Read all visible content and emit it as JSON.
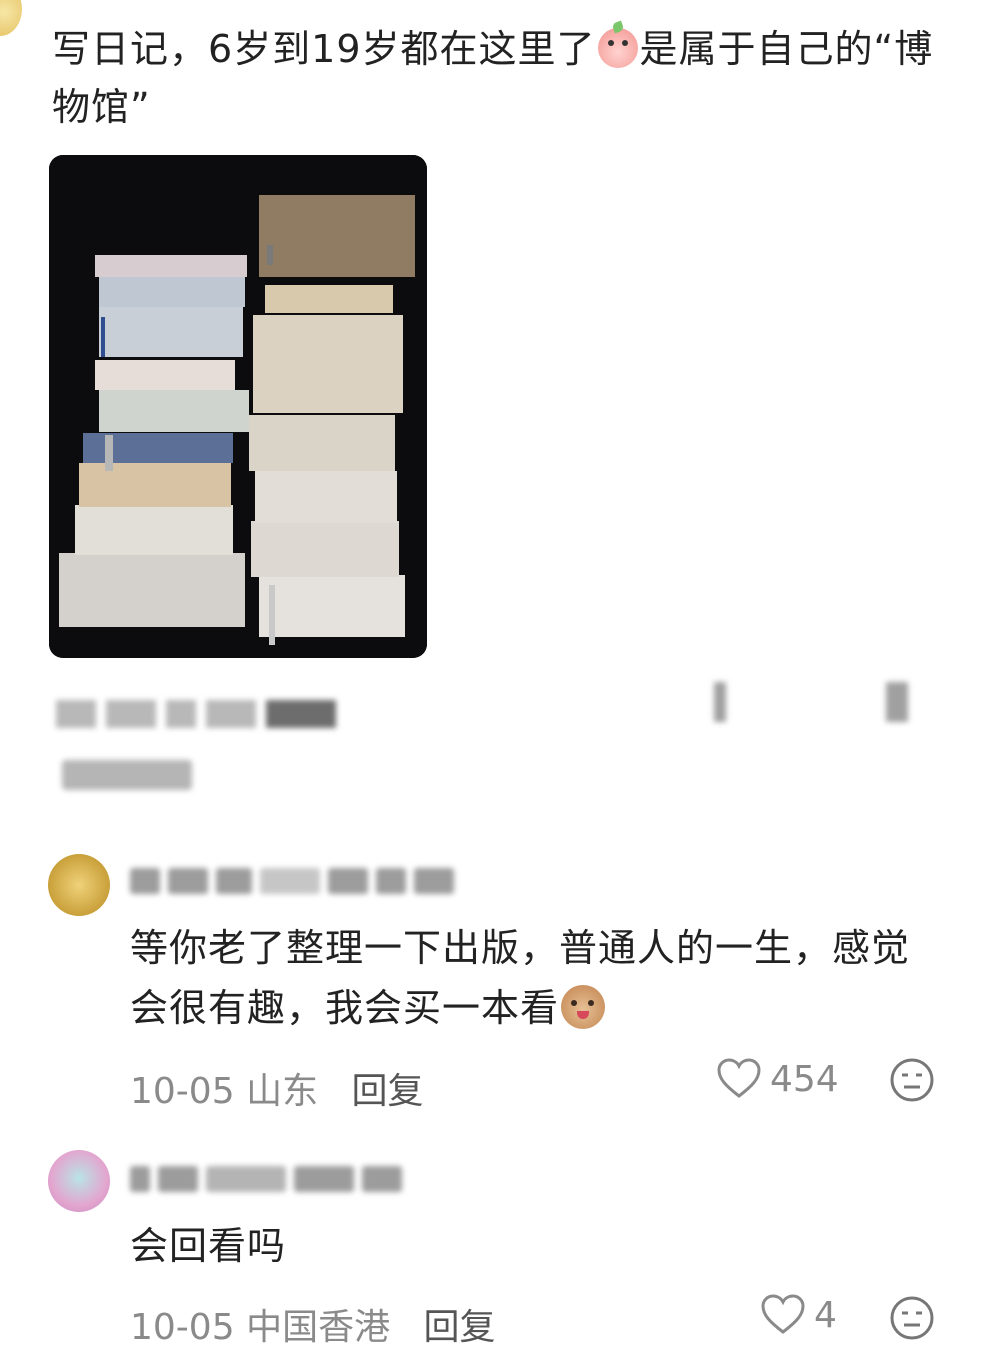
{
  "post": {
    "text_before_emoji": "写日记，6岁到19岁都在这里了",
    "emoji_icon": "peach-face-emoji",
    "text_after_emoji": "是属于自己的“博物馆”"
  },
  "comments": [
    {
      "text": "等你老了整理一下出版，普通人的一生，感觉会很有趣，我会买一本看",
      "emoji_icon": "dog-face-emoji",
      "date": "10-05",
      "location": "山东",
      "reply_label": "回复",
      "likes": "454"
    },
    {
      "text": "会回看吗",
      "date": "10-05",
      "location": "中国香港",
      "reply_label": "回复",
      "likes": "4"
    }
  ],
  "colors": {
    "text": "#222222",
    "meta": "#8a8a8a",
    "photo_background": "#0c0b0d"
  }
}
